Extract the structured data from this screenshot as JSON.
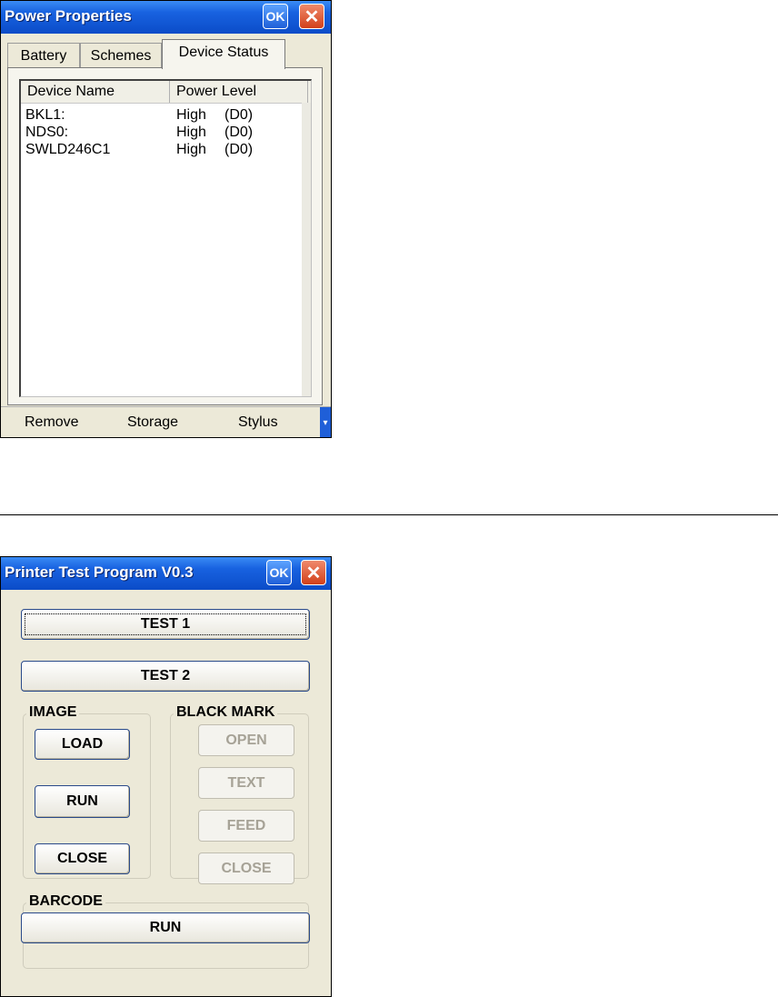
{
  "power_window": {
    "title": "Power Properties",
    "ok_label": "OK",
    "close_glyph": "✕",
    "tabs": [
      {
        "label": "Battery",
        "active": false
      },
      {
        "label": "Schemes",
        "active": false
      },
      {
        "label": "Device Status",
        "active": true
      }
    ],
    "columns": [
      "Device Name",
      "Power Level"
    ],
    "rows": [
      {
        "name": "BKL1:",
        "level": "High",
        "state": "(D0)"
      },
      {
        "name": "NDS0:",
        "level": "High",
        "state": "(D0)"
      },
      {
        "name": "SWLD246C1",
        "level": "High",
        "state": "(D0)"
      }
    ],
    "bottom_items": [
      "Remove",
      "Storage",
      "Stylus"
    ],
    "scroll_arrow": "▾"
  },
  "printer_window": {
    "title": "Printer Test Program V0.3",
    "ok_label": "OK",
    "close_glyph": "✕",
    "test1_label": "TEST 1",
    "test2_label": "TEST 2",
    "image_group": {
      "label": "IMAGE",
      "buttons": [
        "LOAD",
        "RUN",
        "CLOSE"
      ]
    },
    "blackmark_group": {
      "label": "BLACK MARK",
      "buttons": [
        "OPEN",
        "TEXT",
        "FEED",
        "CLOSE"
      ]
    },
    "barcode_group": {
      "label": "BARCODE",
      "run_label": "RUN"
    }
  },
  "colors": {
    "titlebar": "#0b4cc8",
    "window_bg": "#ece9d8",
    "disabled_text": "#a6a296"
  }
}
